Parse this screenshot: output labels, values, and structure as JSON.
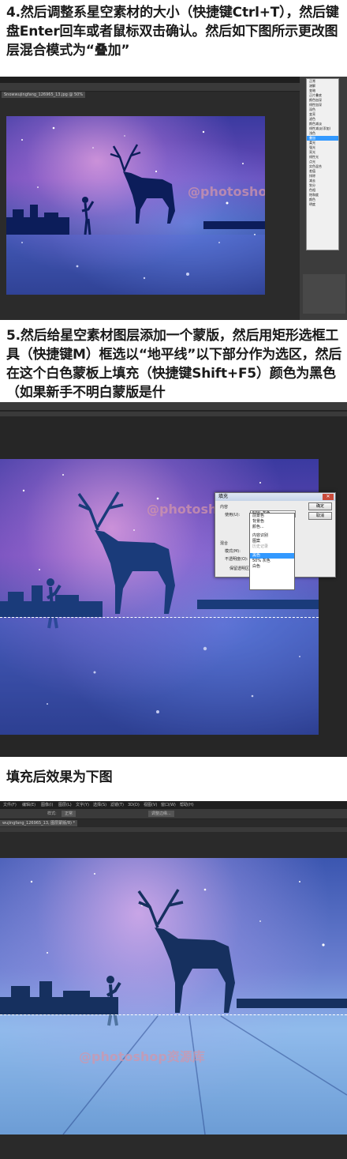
{
  "captions": {
    "step4": "4.然后调整系星空素材的大小（快捷键Ctrl+T），然后键盘Enter回车或者鼠标双击确认。然后如下图所示更改图层混合模式为“叠加”",
    "step5": "5.然后给星空素材图层添加一个蒙版，然后用矩形选框工具（快捷键M）框选以“地平线”以下部分作为选区，然后在这个白色蒙板上填充（快捷键Shift+F5）颜色为黑色（如果新手不明白蒙版是什",
    "result": "填充后效果为下图"
  },
  "watermark": "@photoshop资源库",
  "shot1": {
    "doc_tab": "Snowwujingfang_126965_13.jpg @ 50%",
    "blend_menu": [
      "正常",
      "溶解",
      "",
      "变暗",
      "正片叠底",
      "颜色加深",
      "线性加深",
      "深色",
      "",
      "变亮",
      "滤色",
      "颜色减淡",
      "线性减淡(添加)",
      "浅色",
      "",
      "叠加",
      "柔光",
      "强光",
      "亮光",
      "线性光",
      "点光",
      "实色混合",
      "",
      "差值",
      "排除",
      "减去",
      "划分",
      "",
      "色相",
      "饱和度",
      "颜色",
      "明度"
    ],
    "blend_selected": "叠加"
  },
  "shot2": {
    "dialog_title": "填充",
    "content_group": "内容",
    "use_label": "使用(U):",
    "use_value": "50% 灰色",
    "ok": "确定",
    "cancel": "取消",
    "blend_group": "混合",
    "mode_label": "模式(M):",
    "opacity_label": "不透明度(O):",
    "preserve_label": "保留透明区域(P)",
    "dropdown_items": [
      "前景色",
      "背景色",
      "颜色...",
      "",
      "内容识别",
      "图案",
      "历史记录",
      "",
      "黑色",
      "50% 灰色",
      "白色"
    ],
    "dropdown_highlight": "黑色"
  },
  "shot3": {
    "menu_items": [
      "文件(F)",
      "编辑(E)",
      "图像(I)",
      "图层(L)",
      "文字(Y)",
      "选择(S)",
      "滤镜(T)",
      "3D(D)",
      "视图(V)",
      "窗口(W)",
      "帮助(H)"
    ],
    "doc_tab": "wujingfang_126965_13, 图层蒙版/8) *",
    "mode_label": "样式:",
    "mode_value": "正常",
    "refine_button": "调整边缘..."
  }
}
